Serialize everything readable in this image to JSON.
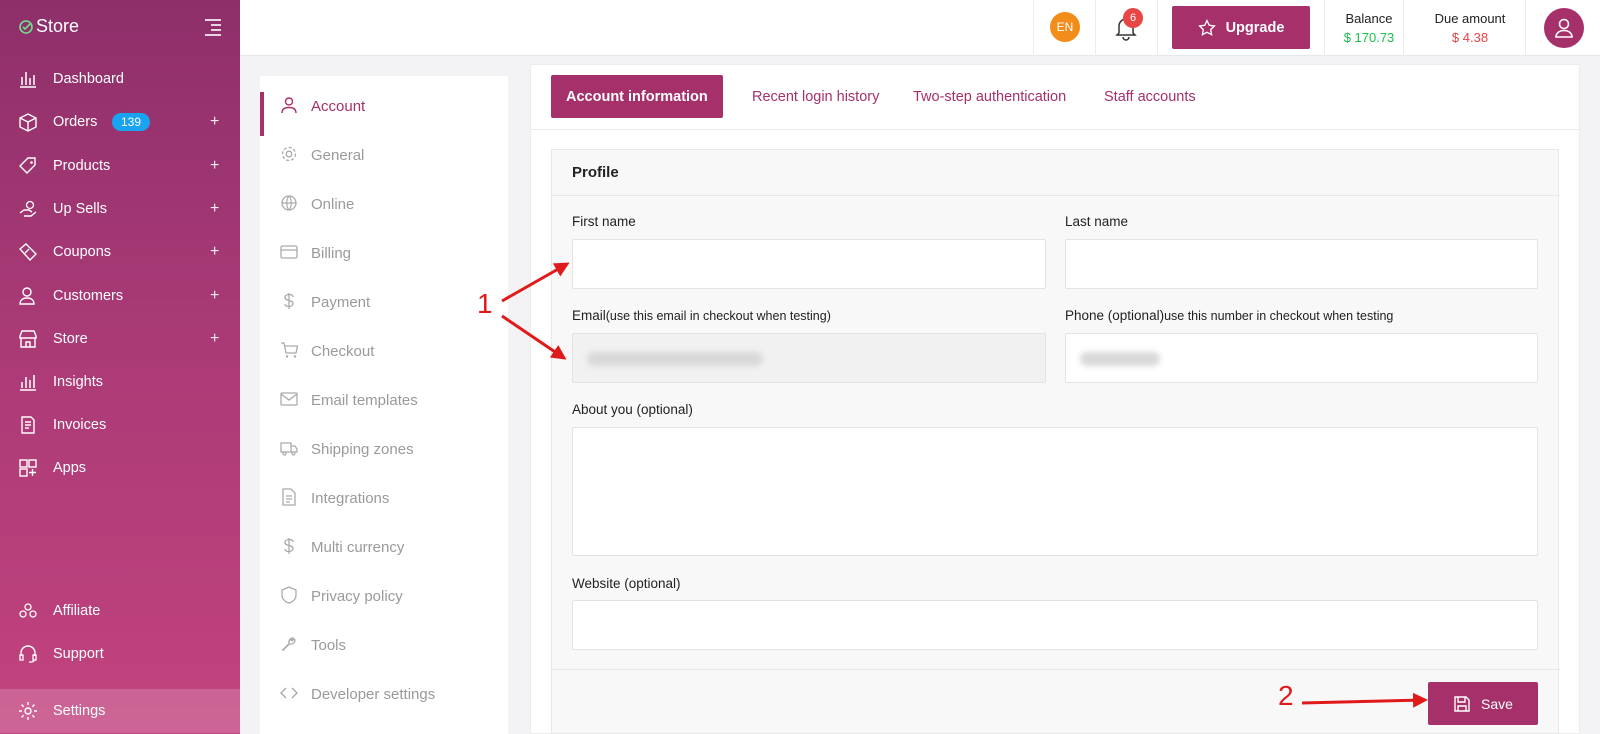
{
  "brand": {
    "name": "Store"
  },
  "sidebar": {
    "items": [
      {
        "label": "Dashboard",
        "icon": "chart-bar-icon"
      },
      {
        "label": "Orders",
        "icon": "box-icon",
        "badge": "139",
        "plus": "+"
      },
      {
        "label": "Products",
        "icon": "tag-icon",
        "plus": "+"
      },
      {
        "label": "Up Sells",
        "icon": "hand-dollar-icon",
        "plus": "+"
      },
      {
        "label": "Coupons",
        "icon": "coupon-icon",
        "plus": "+"
      },
      {
        "label": "Customers",
        "icon": "users-icon",
        "plus": "+"
      },
      {
        "label": "Store",
        "icon": "storefront-icon",
        "plus": "+"
      },
      {
        "label": "Insights",
        "icon": "insights-icon"
      },
      {
        "label": "Invoices",
        "icon": "invoice-icon"
      },
      {
        "label": "Apps",
        "icon": "apps-grid-icon"
      }
    ],
    "bottom": [
      {
        "label": "Affiliate",
        "icon": "affiliate-icon"
      },
      {
        "label": "Support",
        "icon": "headset-icon"
      },
      {
        "label": "Settings",
        "icon": "gear-icon"
      }
    ]
  },
  "topbar": {
    "language": "EN",
    "notifications": "6",
    "upgrade_label": "Upgrade",
    "balance_label": "Balance",
    "balance_value": "$ 170.73",
    "due_label": "Due amount",
    "due_value": "$ 4.38"
  },
  "settings_menu": [
    {
      "label": "Account",
      "icon": "user-icon"
    },
    {
      "label": "General",
      "icon": "gear-icon"
    },
    {
      "label": "Online",
      "icon": "globe-icon"
    },
    {
      "label": "Billing",
      "icon": "credit-card-icon"
    },
    {
      "label": "Payment",
      "icon": "dollar-icon"
    },
    {
      "label": "Checkout",
      "icon": "cart-icon"
    },
    {
      "label": "Email templates",
      "icon": "mail-icon"
    },
    {
      "label": "Shipping zones",
      "icon": "truck-icon"
    },
    {
      "label": "Integrations",
      "icon": "document-icon"
    },
    {
      "label": "Multi currency",
      "icon": "dollar-icon"
    },
    {
      "label": "Privacy policy",
      "icon": "shield-icon"
    },
    {
      "label": "Tools",
      "icon": "wrench-icon"
    },
    {
      "label": "Developer settings",
      "icon": "code-icon"
    }
  ],
  "tabs": [
    "Account information",
    "Recent login history",
    "Two-step authentication",
    "Staff accounts"
  ],
  "profile": {
    "title": "Profile",
    "first_name_label": "First name",
    "last_name_label": "Last name",
    "email_label": "Email",
    "email_hint": "(use this email in checkout when testing)",
    "phone_label": "Phone (optional)",
    "phone_hint": "use this number in checkout when testing",
    "about_label": "About you (optional)",
    "website_label": "Website (optional)",
    "save_label": "Save"
  },
  "annotations": {
    "one": "1",
    "two": "2"
  },
  "colors": {
    "brand": "#a6306a",
    "balance": "#1bbf4a",
    "due": "#e84545",
    "annotation": "#e01a1a"
  }
}
